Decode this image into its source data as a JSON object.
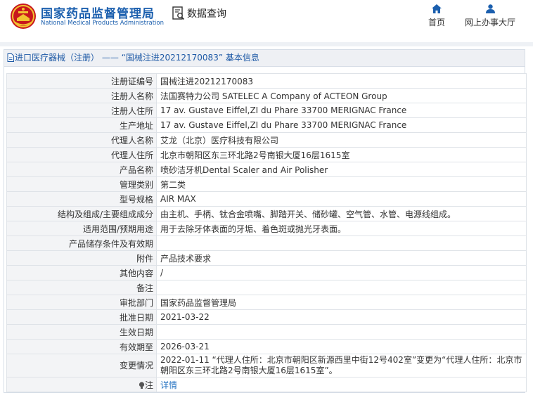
{
  "header": {
    "brand_cn": "国家药品监督管理局",
    "brand_en": "National Medical Products Administration",
    "query_label": "数据查询",
    "nav": [
      {
        "label": "首页",
        "icon": "home-icon"
      },
      {
        "label": "网上办事大厅",
        "icon": "user-icon"
      }
    ]
  },
  "panel": {
    "title": "进口医疗器械（注册） —— “国械注进20212170083” 基本信息"
  },
  "rows": [
    {
      "key": "注册证编号",
      "value": "国械注进20212170083"
    },
    {
      "key": "注册人名称",
      "value": "法国赛特力公司 SATELEC A Company of ACTEON Group"
    },
    {
      "key": "注册人住所",
      "value": "17 av. Gustave Eiffel,ZI du Phare 33700 MERIGNAC France"
    },
    {
      "key": "生产地址",
      "value": "17 av. Gustave Eiffel,ZI du Phare 33700 MERIGNAC France"
    },
    {
      "key": "代理人名称",
      "value": "艾龙（北京）医疗科技有限公司"
    },
    {
      "key": "代理人住所",
      "value": "北京市朝阳区东三环北路2号南银大厦16层1615室"
    },
    {
      "key": "产品名称",
      "value": "喷砂洁牙机Dental Scaler and Air Polisher"
    },
    {
      "key": "管理类别",
      "value": "第二类"
    },
    {
      "key": "型号规格",
      "value": "AIR MAX"
    },
    {
      "key": "结构及组成/主要组成成分",
      "value": "由主机、手柄、钛合金喷嘴、脚踏开关、储砂罐、空气管、水管、电源线组成。"
    },
    {
      "key": "适用范围/预期用途",
      "value": "用于去除牙体表面的牙垢、着色斑或抛光牙表面。"
    },
    {
      "key": "产品储存条件及有效期",
      "value": ""
    },
    {
      "key": "附件",
      "value": "产品技术要求"
    },
    {
      "key": "其他内容",
      "value": "/"
    },
    {
      "key": "备注",
      "value": ""
    },
    {
      "key": "审批部门",
      "value": "国家药品监督管理局"
    },
    {
      "key": "批准日期",
      "value": "2021-03-22"
    },
    {
      "key": "生效日期",
      "value": ""
    },
    {
      "key": "有效期至",
      "value": "2026-03-21"
    },
    {
      "key": "变更情况",
      "value": "2022-01-11 “代理人住所：北京市朝阳区新源西里中街12号402室”变更为“代理人住所：北京市朝阳区东三环北路2号南银大厦16层1615室”。"
    }
  ],
  "note": {
    "key": "注",
    "link_label": "详情"
  }
}
